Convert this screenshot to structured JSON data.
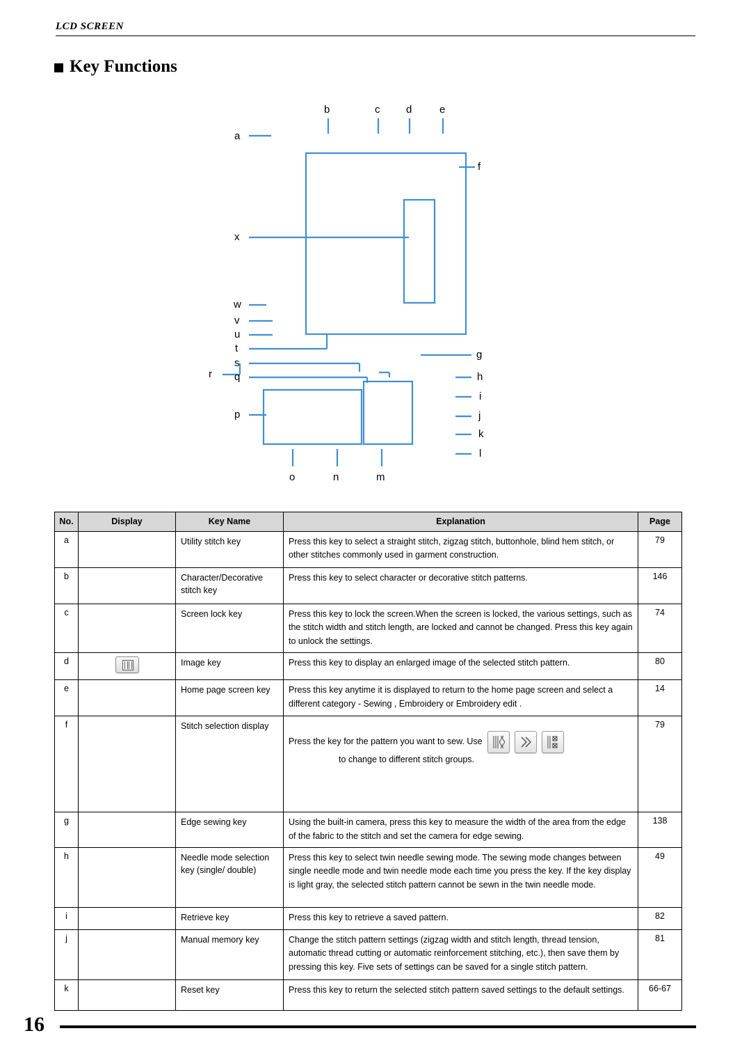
{
  "header": {
    "running_head": "LCD SCREEN"
  },
  "section": {
    "title": "Key Functions"
  },
  "figure": {
    "callouts": [
      {
        "id": "a",
        "label": "a"
      },
      {
        "id": "b",
        "label": "b"
      },
      {
        "id": "c",
        "label": "c"
      },
      {
        "id": "d",
        "label": "d"
      },
      {
        "id": "e",
        "label": "e"
      },
      {
        "id": "f",
        "label": "f"
      },
      {
        "id": "g",
        "label": "g"
      },
      {
        "id": "h",
        "label": "h"
      },
      {
        "id": "i",
        "label": "i"
      },
      {
        "id": "j",
        "label": "j"
      },
      {
        "id": "k",
        "label": "k"
      },
      {
        "id": "l",
        "label": "l"
      },
      {
        "id": "m",
        "label": "m"
      },
      {
        "id": "n",
        "label": "n"
      },
      {
        "id": "o",
        "label": "o"
      },
      {
        "id": "p",
        "label": "p"
      },
      {
        "id": "q",
        "label": "q"
      },
      {
        "id": "r",
        "label": "r"
      },
      {
        "id": "s",
        "label": "s"
      },
      {
        "id": "t",
        "label": "t"
      },
      {
        "id": "u",
        "label": "u"
      },
      {
        "id": "v",
        "label": "v"
      },
      {
        "id": "w",
        "label": "w"
      },
      {
        "id": "x",
        "label": "x"
      }
    ]
  },
  "table": {
    "headers": {
      "no": "No.",
      "display": "Display",
      "key_name": "Key Name",
      "explanation": "Explanation",
      "page": "Page"
    },
    "rows": [
      {
        "no": "a",
        "key_name": "Utility stitch key",
        "explanation": "Press this key to select a straight stitch, zigzag stitch, buttonhole, blind hem stitch, or other stitches commonly used in garment construction.",
        "page": "79"
      },
      {
        "no": "b",
        "key_name": "Character/Decorative stitch key",
        "explanation": "Press this key to select character or decorative stitch patterns.",
        "page": "146"
      },
      {
        "no": "c",
        "key_name": "Screen lock key",
        "explanation": "Press this key to lock the screen.When the screen is locked, the various settings, such as the stitch width and stitch length, are locked and cannot be changed. Press this key again to unlock the settings.",
        "page": "74"
      },
      {
        "no": "d",
        "key_name": "Image key",
        "explanation": "Press this key to display an enlarged image of the selected stitch pattern.",
        "page": "80",
        "display_icon": "image-key-icon"
      },
      {
        "no": "e",
        "key_name": "Home page screen key",
        "explanation": "Press this key anytime it is displayed to return to the home page screen and select a different category -  Sewing ,  Embroidery  or  Embroidery edit .",
        "page": "14"
      },
      {
        "no": "f",
        "key_name": "Stitch selection display",
        "explanation_line1": "Press the key for the pattern you want to sew. Use",
        "explanation_line2": "to change to different stitch groups.",
        "explanation_icons": [
          "utility-stitch-icon",
          "stitch-group-icon",
          "decorative-stitch-icon"
        ],
        "page": "79"
      },
      {
        "no": "g",
        "key_name": "Edge sewing key",
        "explanation": "Using the built-in camera, press this key to measure the width of the area from the edge of the fabric to the stitch and set the camera for edge sewing.",
        "page": "138"
      },
      {
        "no": "h",
        "key_name": "Needle mode selection key (single/ double)",
        "explanation": "Press this key to select twin needle sewing mode. The sewing mode changes between single needle mode and twin needle mode each time you press the key. If the key display is light gray, the selected stitch pattern cannot be sewn in the twin needle mode.",
        "page": "49"
      },
      {
        "no": "i",
        "key_name": "Retrieve key",
        "explanation": "Press this key to retrieve a saved pattern.",
        "page": "82"
      },
      {
        "no": "j",
        "key_name": "Manual memory key",
        "explanation": "Change the stitch pattern settings (zigzag width and stitch length, thread tension, automatic thread cutting or automatic reinforcement stitching, etc.), then save them by pressing this key. Five sets of settings can be saved for a single stitch pattern.",
        "page": "81"
      },
      {
        "no": "k",
        "key_name": "Reset key",
        "explanation": "Press this key to return the selected stitch pattern saved settings to the default settings.",
        "page": "66-67"
      }
    ]
  },
  "footer": {
    "page_number": "16"
  }
}
